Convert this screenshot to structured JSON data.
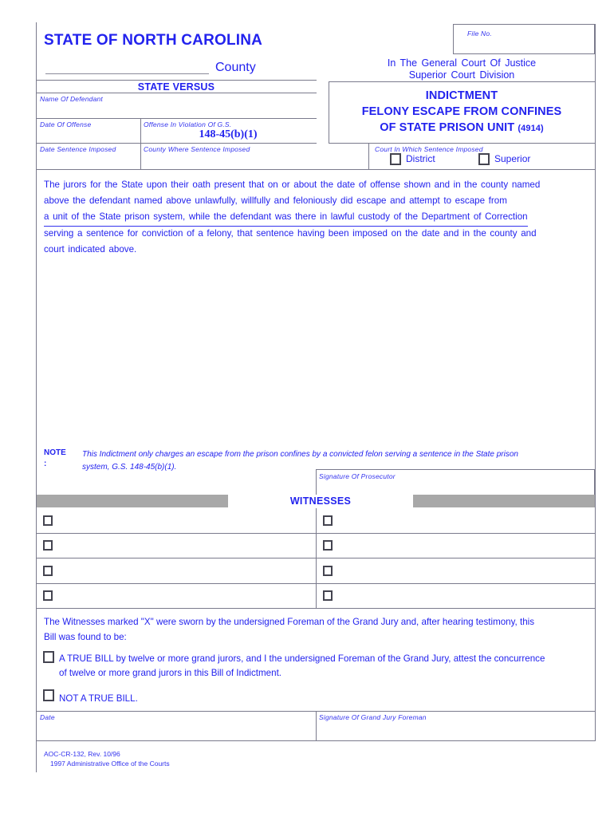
{
  "header": {
    "state_title": "STATE OF NORTH CAROLINA",
    "county_label": "County",
    "file_no_label": "File No.",
    "court_line_1": "In The General Court Of Justice",
    "court_line_2": "Superior Court Division",
    "state_versus": "STATE VERSUS"
  },
  "doc_title": {
    "line1": "INDICTMENT",
    "line2": "FELONY ESCAPE FROM CONFINES",
    "line3": "OF STATE PRISON UNIT",
    "form_number": "(4914)"
  },
  "fields": {
    "name_of_defendant": "Name Of Defendant",
    "date_of_offense": "Date Of Offense",
    "offense_in_violation": "Offense In Violation Of G.S.",
    "gs_number": "148-45(b)(1)",
    "date_sentence_imposed": "Date Sentence Imposed",
    "county_where_sentence_imposed": "County Where Sentence Imposed",
    "court_in_which_sentence_imposed": "Court In Which Sentence Imposed",
    "district_label": "District",
    "superior_label": "Superior",
    "signature_of_prosecutor": "Signature Of Prosecutor",
    "date_label": "Date",
    "signature_of_grand_jury_foreman": "Signature Of Grand Jury Foreman"
  },
  "body": {
    "line1": "The jurors for the State upon their oath present that on or about the date of offense shown and in the county named",
    "line2": "above the defendant named above unlawfully,  willfully  and feloniously did escape and attempt to escape from",
    "line3": "a unit of the State prison system, while the defendant was there in lawful custody of the Department of Correction",
    "line4": "serving a sentence for conviction of a felony, that sentence having been imposed on the date and in the county and",
    "line5": "court indicated above."
  },
  "note": {
    "label": "NOTE",
    "colon": ":",
    "line1": "This Indictment only charges an escape from the prison confines by a convicted felon serving a sentence in the State prison",
    "line2": "system, G.S. 148-45(b)(1)."
  },
  "witnesses": {
    "heading": "WITNESSES",
    "rows": [
      {
        "left": "",
        "right": ""
      },
      {
        "left": "",
        "right": ""
      },
      {
        "left": "",
        "right": ""
      },
      {
        "left": "",
        "right": ""
      }
    ]
  },
  "bill": {
    "intro_line1": "The Witnesses marked \"X\" were sworn by the undersigned Foreman of the Grand Jury and, after hearing testimony, this",
    "intro_line2": "Bill was found to be:",
    "true_bill_line1": "A TRUE BILL by twelve or more grand jurors, and I the undersigned Foreman of the Grand Jury, attest the concurrence",
    "true_bill_line2": "of twelve or more grand jurors in this Bill of Indictment.",
    "not_true_bill": "NOT A TRUE BILL."
  },
  "footer": {
    "form_id": "AOC-CR-132, Rev. 10/96",
    "copyright": "1997 Administrative Office of the Courts"
  },
  "colors": {
    "ink": "#2222ee",
    "rule": "#7a7a8c",
    "band": "#a8a8a8",
    "checkbox": "#444450"
  }
}
